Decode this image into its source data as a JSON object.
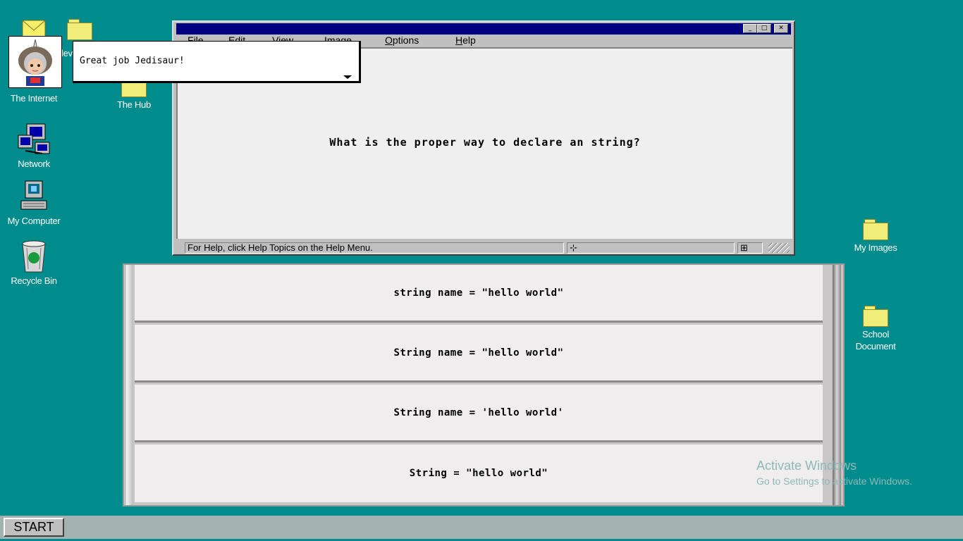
{
  "desktop": {
    "icons": [
      {
        "label": "The Internet"
      },
      {
        "label": "The Hub"
      },
      {
        "label": "Network"
      },
      {
        "label": "My Computer"
      },
      {
        "label": "Recycle Bin"
      },
      {
        "label": "My Images"
      },
      {
        "label": "School Document"
      }
    ],
    "partial_icon_label": "lev"
  },
  "window": {
    "menu": [
      "File",
      "Edit",
      "View",
      "Image",
      "Options",
      "Help"
    ],
    "question": "What is the proper way to declare an string?",
    "status_text": "For Help, click Help Topics on the Help Menu."
  },
  "answers": [
    {
      "text": "string name = \"hello world\""
    },
    {
      "text": "String name = \"hello world\""
    },
    {
      "text": "String name = 'hello world'"
    },
    {
      "text": "String = \"hello world\""
    }
  ],
  "assistant": {
    "message": "Great job Jedisaur!"
  },
  "taskbar": {
    "start_label": "START"
  },
  "watermark": {
    "title": "Activate Windows",
    "subtitle": "Go to Settings to activate Windows."
  }
}
